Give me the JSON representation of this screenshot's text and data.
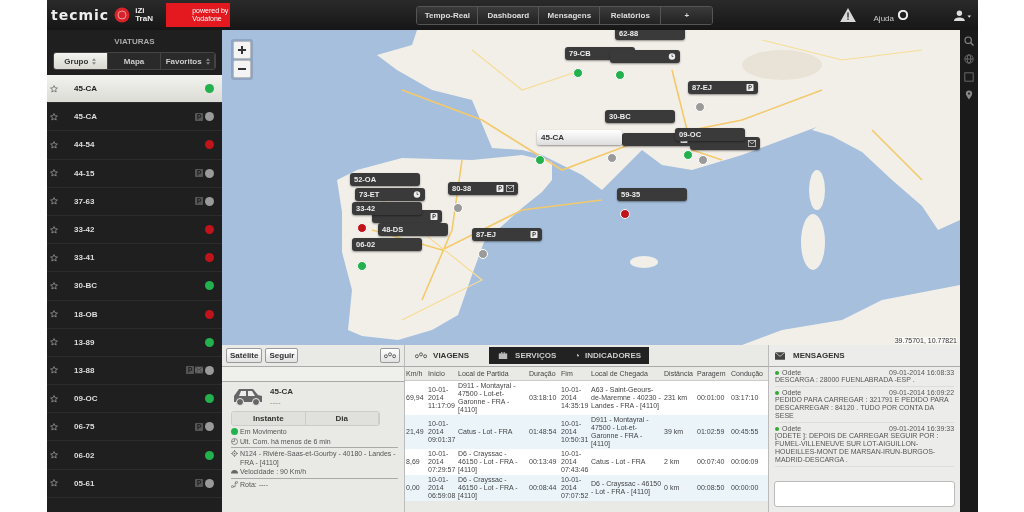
{
  "header": {
    "brand": "tecmic",
    "product": "iZi TraN",
    "partner": "powered by Vodafone",
    "help": "Ajuda",
    "nav": [
      {
        "label": "Tempo-Real",
        "selected": false
      },
      {
        "label": "Dashboard",
        "selected": false
      },
      {
        "label": "Mensagens",
        "selected": false
      },
      {
        "label": "Relatórios",
        "selected": false
      },
      {
        "label": "+",
        "selected": false
      }
    ]
  },
  "sidebar": {
    "title": "VIATURAS",
    "tabs": [
      {
        "label": "Grupo",
        "selected": true,
        "sortable": true
      },
      {
        "label": "Mapa",
        "selected": false,
        "sortable": false
      },
      {
        "label": "Favoritos",
        "selected": false,
        "sortable": true
      }
    ],
    "vehicles": [
      {
        "plate": "45-CA",
        "selected": true,
        "color": "#22b14c",
        "parked": false,
        "message": false
      },
      {
        "plate": "45-CA",
        "selected": false,
        "color": "#9a9a9a",
        "parked": true,
        "message": false
      },
      {
        "plate": "44-54",
        "selected": false,
        "color": "#c0141a",
        "parked": false,
        "message": false
      },
      {
        "plate": "44-15",
        "selected": false,
        "color": "#9a9a9a",
        "parked": true,
        "message": false
      },
      {
        "plate": "37-63",
        "selected": false,
        "color": "#9a9a9a",
        "parked": true,
        "message": false
      },
      {
        "plate": "33-42",
        "selected": false,
        "color": "#c0141a",
        "parked": false,
        "message": false
      },
      {
        "plate": "33-41",
        "selected": false,
        "color": "#c0141a",
        "parked": false,
        "message": false
      },
      {
        "plate": "30-BC",
        "selected": false,
        "color": "#22b14c",
        "parked": false,
        "message": false
      },
      {
        "plate": "18-OB",
        "selected": false,
        "color": "#c0141a",
        "parked": false,
        "message": false
      },
      {
        "plate": "13-89",
        "selected": false,
        "color": "#22b14c",
        "parked": false,
        "message": false
      },
      {
        "plate": "13-88",
        "selected": false,
        "color": "#9a9a9a",
        "parked": true,
        "message": true
      },
      {
        "plate": "09-OC",
        "selected": false,
        "color": "#22b14c",
        "parked": false,
        "message": false
      },
      {
        "plate": "06-75",
        "selected": false,
        "color": "#9a9a9a",
        "parked": true,
        "message": false
      },
      {
        "plate": "06-02",
        "selected": false,
        "color": "#22b14c",
        "parked": false,
        "message": false
      },
      {
        "plate": "05-61",
        "selected": false,
        "color": "#9a9a9a",
        "parked": true,
        "message": false
      }
    ]
  },
  "map": {
    "coordinates": "39.75701, 10.77821",
    "markers": [
      {
        "label": "62-88",
        "selected": false
      },
      {
        "label": "79-CB",
        "selected": false,
        "color": "#22b14c"
      },
      {
        "selected": false,
        "color": "#22b14c",
        "icons": [
          {
            "kind": "clock"
          }
        ]
      },
      {
        "label": "87-EJ",
        "selected": false,
        "color": "#9a9a9a",
        "icons": [
          {
            "kind": "parking"
          }
        ]
      },
      {
        "label": "30-BC",
        "selected": false,
        "color": "#9a9a9a"
      },
      {
        "selected": false,
        "icons": [
          {
            "kind": "parking"
          }
        ]
      },
      {
        "label": "45-CA",
        "selected": true,
        "color": "#22b14c"
      },
      {
        "selected": false,
        "color": "#9a9a9a",
        "icons": [
          {
            "kind": "mail"
          }
        ]
      },
      {
        "label": "09-OC",
        "selected": false,
        "color": "#22b14c"
      },
      {
        "label": "52-OA",
        "selected": false
      },
      {
        "label": "73-ET",
        "selected": false,
        "icons": [
          {
            "kind": "clock"
          }
        ]
      },
      {
        "selected": false,
        "icons": [
          {
            "kind": "parking"
          }
        ]
      },
      {
        "label": "33-42",
        "selected": false,
        "color": "#c0141a"
      },
      {
        "label": "80-38",
        "selected": false,
        "color": "#9a9a9a",
        "icons": [
          {
            "kind": "parking"
          },
          {
            "kind": "mail"
          }
        ]
      },
      {
        "label": "48-DS",
        "selected": false
      },
      {
        "label": "06-02",
        "selected": false,
        "color": "#22b14c"
      },
      {
        "label": "87-EJ",
        "selected": false,
        "color": "#9a9a9a",
        "icons": [
          {
            "kind": "parking"
          }
        ]
      },
      {
        "label": "59-35",
        "selected": false,
        "color": "#c0141a"
      }
    ]
  },
  "vehicle_panel": {
    "buttons": [
      "Satélite",
      "Seguir"
    ],
    "plate": "45-CA",
    "driver": "----",
    "modes": [
      {
        "label": "Instante",
        "selected": false
      },
      {
        "label": "Dia",
        "selected": false
      }
    ],
    "status": {
      "text": "Em Movimento",
      "color": "#22b14c"
    },
    "last_contact": "Ult. Com. há menos de 6 min",
    "location": "N124 - Rivière-Saas-et-Gourby - 40180 - Landes - FRA - [4110]",
    "speed": "Velocidade : 90 Km/h",
    "route": "Rota: ----"
  },
  "trips": {
    "tabs": [
      {
        "label": "VIAGENS",
        "selected": true
      },
      {
        "label": "SERVIÇOS",
        "selected": false
      },
      {
        "label": "INDICADORES",
        "selected": false
      }
    ],
    "columns": [
      "Km/h",
      "Início",
      "Local de Partida",
      "Duração",
      "Fim",
      "Local de Chegada",
      "Distância",
      "Paragem",
      "Condução"
    ],
    "rows": [
      [
        "69,94",
        "10-01-2014 11:17:09",
        "D911 - Montayral - 47500 - Lot-et-Garonne - FRA - [4110]",
        "03:18:10",
        "10-01-2014 14:35:19",
        "A63 - Saint-Geours-de-Maremne - 40230 - Landes - FRA - [4110]",
        "231 km",
        "00:01:00",
        "03:17:10"
      ],
      [
        "21,49",
        "10-01-2014 09:01:37",
        "Catus - Lot - FRA",
        "01:48:54",
        "10-01-2014 10:50:31",
        "D911 - Montayral - 47500 - Lot-et-Garonne - FRA - [4110]",
        "39 km",
        "01:02:59",
        "00:45:55"
      ],
      [
        "8,69",
        "10-01-2014 07:29:57",
        "D6 - Crayssac - 46150 - Lot - FRA - [4110]",
        "00:13:49",
        "10-01-2014 07:43:46",
        "Catus - Lot - FRA",
        "2 km",
        "00:07:40",
        "00:06:09"
      ],
      [
        "0,00",
        "10-01-2014 06:59:08",
        "D6 - Crayssac - 46150 - Lot - FRA - [4110]",
        "00:08:44",
        "10-01-2014 07:07:52",
        "D6 - Crayssac - 46150 - Lot - FRA - [4110]",
        "0 km",
        "00:08:50",
        "00:00:00"
      ]
    ]
  },
  "messages": {
    "title": "MENSAGENS",
    "items": [
      {
        "sender": "Odete",
        "time": "09-01-2014 16:08:33",
        "text": "DESCARGA : 28000 FUENLABRADA -ESP ."
      },
      {
        "sender": "Odete",
        "time": "09-01-2014 16:09:22",
        "text": "PEDIDO PARA CARREGAR : 321791 E PEDIDO PARA DESCARREGAR : 84120 . TUDO POR CONTA DA SESE"
      },
      {
        "sender": "Odete",
        "time": "09-01-2014 16:39:33",
        "text": "[ODETE ]: DEPOIS DE CARREGAR SEGUIR POR : FUMEL-VILLENEUVE SUR LOT-AIGUILLON-HOUEILLES-MONT DE MARSAN-IRUN-BURGOS-MADRID-DESCARGA ."
      }
    ]
  }
}
